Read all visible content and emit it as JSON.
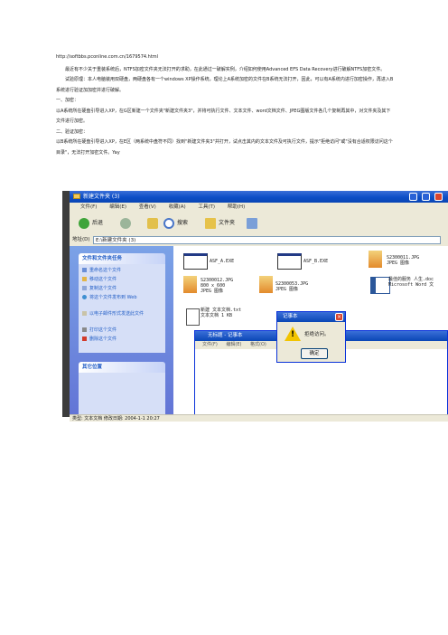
{
  "doc": {
    "url": "http://softbbs.pconline.com.cn/1679574.html",
    "intro": "最近有不少关于重装系统后，NTFS加密文件夹无法打开的求助，在此通过一破解实例，介绍如何使用Advanced EFS Data Recovery进行破解NTFS加密文件。",
    "principle": "试验原理：本人电脑装用双硬盘，两硬盘各有一个windows XP操作系统，理论上A系统加密的文件在B系统无法打开，因此，可以有A系统内进行加密操作，再进入B系统进行验证加加密并进行破解。",
    "s1_title": "一、加密：",
    "s1_body": "以A系统所在硬盘引导进入XP，在G区新建一个文件夹\"新建文件夹3\"，并将可执行文件、文本文件、word文档文件、JPEG图版文件各几个复制再其中，对文件夹及其下文件进行加密。",
    "s2_title": "二、验证加密：",
    "s2_body": "以B系统所在硬盘引导进入XP，在E区（两系统中盘符不同）找到\"新建文件夹3\"并打开，试点击其内的文本文件及可执行文件，提示\"拒绝访问\"或\"没有合适权限访问这个目录\"，无法打开加密文件。Yay"
  },
  "explorer": {
    "title": "新建文件夹 (3)",
    "menu": [
      "文件(F)",
      "编辑(E)",
      "查看(V)",
      "收藏(A)",
      "工具(T)",
      "帮助(H)"
    ],
    "toolbar": {
      "back": "后退",
      "search": "搜索",
      "folders": "文件夹"
    },
    "address_label": "地址(D)",
    "address_value": "E:\\新建文件夹 (3)",
    "task_panel_title": "文件和文件夹任务",
    "tasks": [
      "重命名这个文件",
      "移动这个文件",
      "复制这个文件",
      "将这个文件发布到 Web",
      "以电子邮件形式发送此文件",
      "打印这个文件",
      "删除这个文件"
    ],
    "places_title": "其它位置",
    "files": [
      {
        "name": "ASF_A.EXE",
        "sub": ""
      },
      {
        "name": "ASF_B.EXE",
        "sub": ""
      },
      {
        "name": "S2300011.JPG",
        "sub": "JPEG 图像"
      },
      {
        "name": "S2300012.JPG",
        "sub": "800 x 600\nJPEG 图像"
      },
      {
        "name": "S2300053.JPG",
        "sub": "JPEG 图像"
      },
      {
        "name": "最佳的服务 人生.doc",
        "sub": "Microsoft Word 文"
      },
      {
        "name": "新建 文本文档.txt",
        "sub": "文本文档\n1 KB"
      }
    ],
    "status": "类型: 文本文档 修改日期: 2004-1-1 20:27"
  },
  "notepad": {
    "title": "无标题 - 记事本",
    "menu": [
      "文件(F)",
      "编辑(E)",
      "格式(O)"
    ]
  },
  "msgbox": {
    "title": "记事本",
    "message": "拒绝访问。",
    "ok": "确定"
  },
  "colors": {
    "xp_blue": "#0c4ec6",
    "task_bg": "#6f8ce0",
    "warning": "#f2c400"
  }
}
